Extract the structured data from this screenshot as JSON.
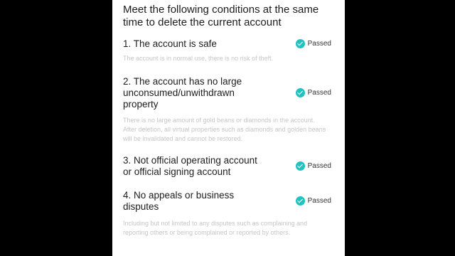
{
  "heading": "Meet the following conditions at the same time to delete the current account",
  "status_label": "Passed",
  "status_color": "#22c2c0",
  "conditions": [
    {
      "title": "1. The account is safe",
      "status": "Passed",
      "description": "The account is in normal use, there is no risk of theft."
    },
    {
      "title": "2. The account has no large unconsumed/unwithdrawn property",
      "status": "Passed",
      "description": "There is no large amount of gold beans or diamonds in the account. After deletion, all virtual properties such as diamonds and golden beans will be invalidated and cannot be restored."
    },
    {
      "title": "3. Not official operating account or official signing account",
      "status": "Passed",
      "description": ""
    },
    {
      "title": "4. No appeals or business disputes",
      "status": "Passed",
      "description": "Including but not limited to any disputes such as complaining and reporting others or being complained or reported by others."
    }
  ]
}
